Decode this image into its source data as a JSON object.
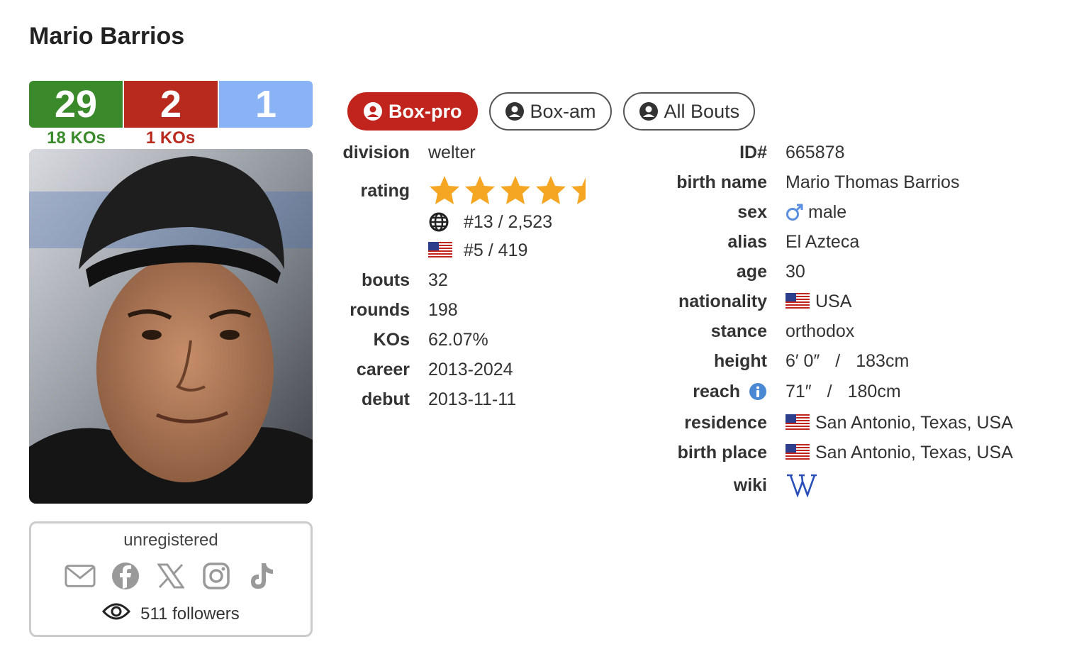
{
  "boxer": {
    "name": "Mario Barrios",
    "record": {
      "wins": "29",
      "losses": "2",
      "draws": "1",
      "win_kos": "18 KOs",
      "loss_kos": "1 KOs"
    }
  },
  "social": {
    "status": "unregistered",
    "icons": [
      "email-icon",
      "facebook-icon",
      "x-icon",
      "instagram-icon",
      "tiktok-icon"
    ],
    "followers": "511 followers"
  },
  "tabs": [
    {
      "label": "Box-pro",
      "active": true
    },
    {
      "label": "Box-am",
      "active": false
    },
    {
      "label": "All Bouts",
      "active": false
    }
  ],
  "stats": {
    "division": {
      "label": "division",
      "value": "welter"
    },
    "rating": {
      "label": "rating",
      "stars": 4.5,
      "world_rank": "#13 / 2,523",
      "country_rank": "#5 / 419"
    },
    "bouts": {
      "label": "bouts",
      "value": "32"
    },
    "rounds": {
      "label": "rounds",
      "value": "198"
    },
    "kos": {
      "label": "KOs",
      "value": "62.07%"
    },
    "career": {
      "label": "career",
      "value": "2013-2024"
    },
    "debut": {
      "label": "debut",
      "value": "2013-11-11"
    }
  },
  "bio": {
    "id": {
      "label": "ID#",
      "value": "665878"
    },
    "birth_name": {
      "label": "birth name",
      "value": "Mario Thomas Barrios"
    },
    "sex": {
      "label": "sex",
      "value": "male"
    },
    "alias": {
      "label": "alias",
      "value": "El Azteca"
    },
    "age": {
      "label": "age",
      "value": "30"
    },
    "nationality": {
      "label": "nationality",
      "value": "USA"
    },
    "stance": {
      "label": "stance",
      "value": "orthodox"
    },
    "height": {
      "label": "height",
      "imperial": "6′ 0″",
      "sep": "/",
      "metric": "183cm"
    },
    "reach": {
      "label": "reach",
      "imperial": "71″",
      "sep": "/",
      "metric": "180cm"
    },
    "residence": {
      "label": "residence",
      "value": "San Antonio, Texas, USA"
    },
    "birth_place": {
      "label": "birth place",
      "value": "San Antonio, Texas, USA"
    },
    "wiki": {
      "label": "wiki"
    }
  },
  "colors": {
    "win": "#3a8a2c",
    "loss": "#b82a1e",
    "draw": "#8ab3f6",
    "active_tab": "#c0241c",
    "star": "#f5a623",
    "wiki": "#2b4fb8"
  }
}
